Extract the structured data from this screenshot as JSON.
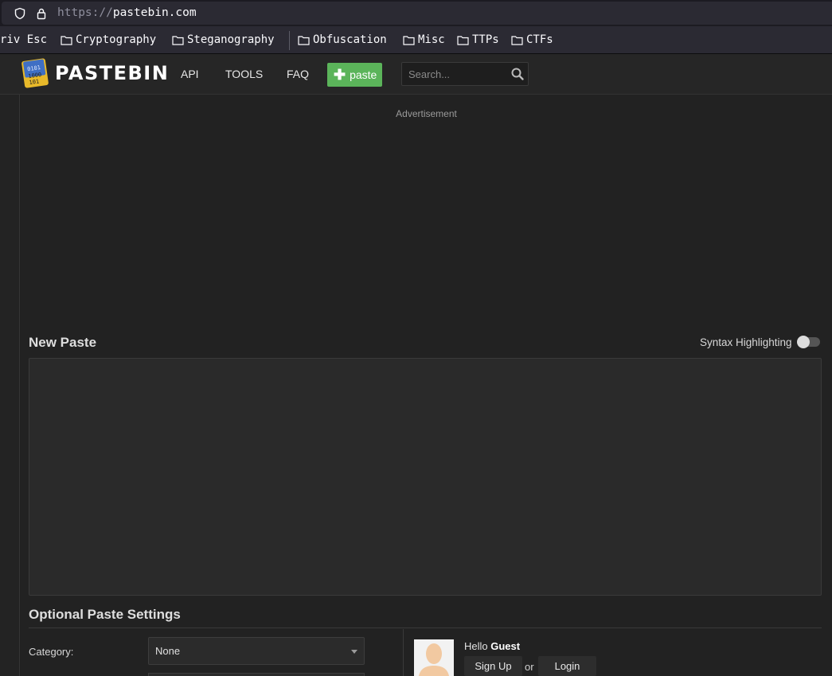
{
  "browser": {
    "url_scheme": "https://",
    "url_host": "pastebin.com",
    "bookmarks": [
      {
        "label": "riv Esc",
        "folder": false
      },
      {
        "label": "Cryptography",
        "folder": true
      },
      {
        "label": "Steganography",
        "folder": true
      },
      {
        "label": "Obfuscation",
        "folder": true
      },
      {
        "label": "Misc",
        "folder": true
      },
      {
        "label": "TTPs",
        "folder": true
      },
      {
        "label": "CTFs",
        "folder": true
      }
    ]
  },
  "header": {
    "logo_text": "PASTEBIN",
    "nav": [
      "API",
      "TOOLS",
      "FAQ"
    ],
    "paste_button": "paste",
    "search_placeholder": "Search..."
  },
  "main": {
    "ad_label": "Advertisement",
    "new_paste_title": "New Paste",
    "syntax_label": "Syntax Highlighting",
    "syntax_enabled": false,
    "paste_content": ""
  },
  "settings": {
    "title": "Optional Paste Settings",
    "category_label": "Category:",
    "category_value": "None"
  },
  "user": {
    "hello": "Hello",
    "name": "Guest",
    "signup": "Sign Up",
    "or": "or",
    "login": "Login"
  },
  "colors": {
    "accent_green": "#5bb45a",
    "background": "#222222"
  }
}
